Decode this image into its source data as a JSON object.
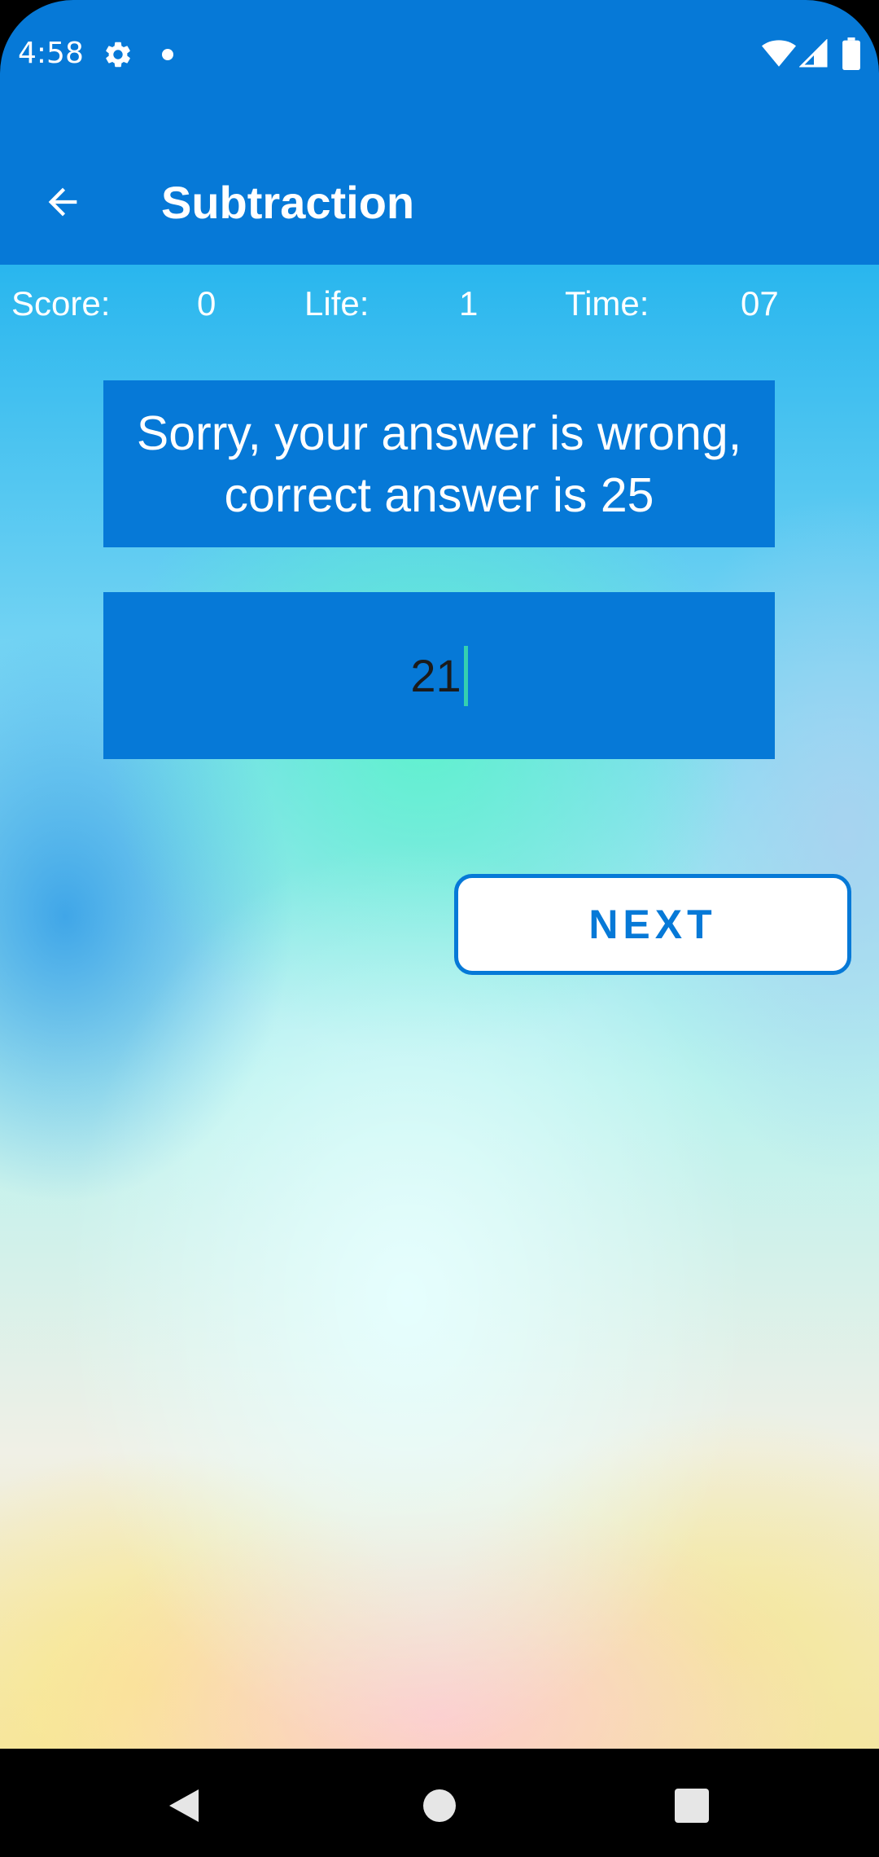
{
  "status_bar": {
    "time": "4:58",
    "icons": [
      "gear-icon",
      "dot-icon",
      "wifi-icon",
      "signal-icon",
      "battery-icon"
    ]
  },
  "app_bar": {
    "title": "Subtraction",
    "back_icon": "arrow-back-icon",
    "background_color": "#0679D7"
  },
  "stats": {
    "score_label": "Score:",
    "score_value": "0",
    "life_label": "Life:",
    "life_value": "1",
    "time_label": "Time:",
    "time_value": "07"
  },
  "feedback": {
    "line1": "Sorry, your answer is wrong,",
    "line2": "correct answer is 25"
  },
  "answer_input": {
    "value": "21"
  },
  "next_button": {
    "label": "NEXT"
  },
  "nav_bar": {
    "icons": [
      "back-triangle-icon",
      "home-circle-icon",
      "recents-square-icon"
    ]
  },
  "colors": {
    "accent": "#0679D7",
    "cursor": "#35D0B0"
  }
}
